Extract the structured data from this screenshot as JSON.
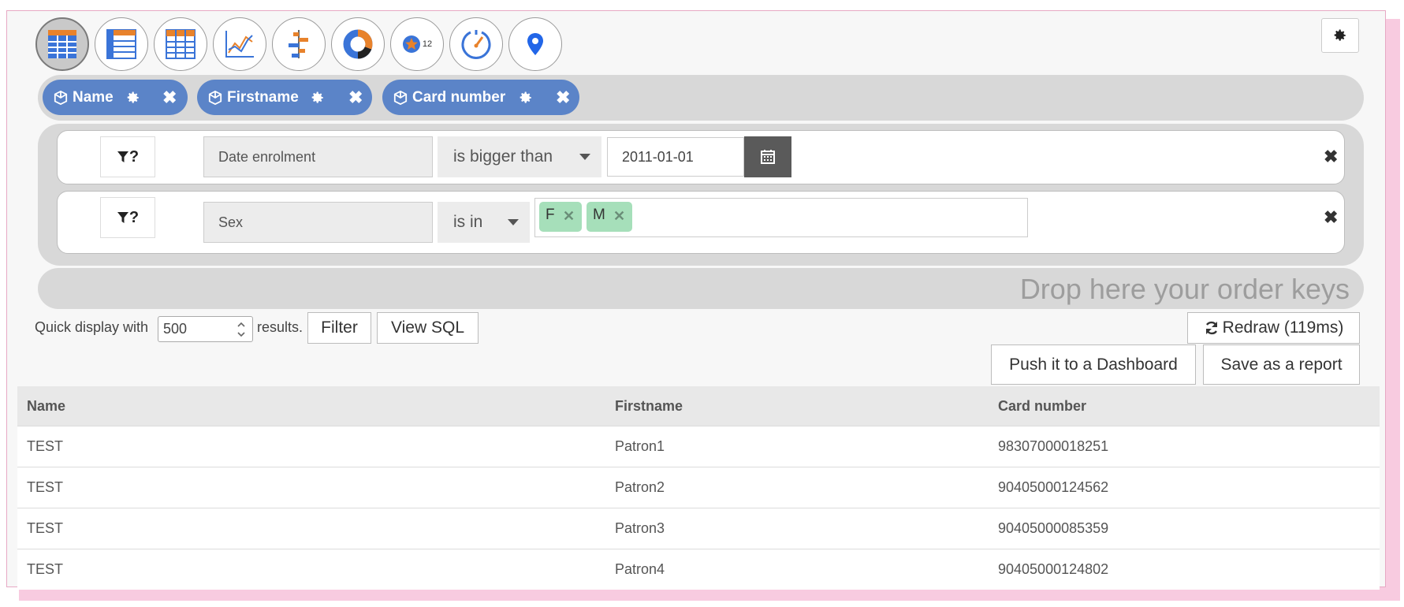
{
  "colors": {
    "accent_blue": "#5b84c8",
    "tag_green": "#a6dfba",
    "calendar_dark": "#5a5a5a",
    "frame_pink": "#f8cbe0"
  },
  "view_switcher": [
    {
      "name": "table-view-icon",
      "active": true
    },
    {
      "name": "list-view-icon",
      "active": false
    },
    {
      "name": "pivot-table-icon",
      "active": false
    },
    {
      "name": "line-chart-icon",
      "active": false
    },
    {
      "name": "bar-chart-icon",
      "active": false
    },
    {
      "name": "donut-chart-icon",
      "active": false
    },
    {
      "name": "number-badge-icon",
      "active": false
    },
    {
      "name": "gauge-icon",
      "active": false
    },
    {
      "name": "map-marker-icon",
      "active": false
    }
  ],
  "badge_count": "12",
  "keys": [
    {
      "label": "Name"
    },
    {
      "label": "Firstname"
    },
    {
      "label": "Card number"
    }
  ],
  "filters": [
    {
      "field": "Date enrolment",
      "operator": "is bigger than",
      "value": "2011-01-01"
    },
    {
      "field": "Sex",
      "operator": "is in",
      "tags": [
        "F",
        "M"
      ]
    }
  ],
  "funnel_label": "?",
  "order_placeholder": "Drop here your order keys",
  "controls": {
    "quick_display_prefix": "Quick display with",
    "limit_value": "500",
    "quick_display_suffix": "results.",
    "filter_button": "Filter",
    "view_sql_button": "View SQL",
    "redraw_button": "Redraw (119ms)",
    "push_dashboard_button": "Push it to a Dashboard",
    "save_report_button": "Save as a report"
  },
  "table": {
    "columns": [
      "Name",
      "Firstname",
      "Card number"
    ],
    "rows": [
      [
        "TEST",
        "Patron1",
        "98307000018251"
      ],
      [
        "TEST",
        "Patron2",
        "90405000124562"
      ],
      [
        "TEST",
        "Patron3",
        "90405000085359"
      ],
      [
        "TEST",
        "Patron4",
        "90405000124802"
      ]
    ]
  }
}
